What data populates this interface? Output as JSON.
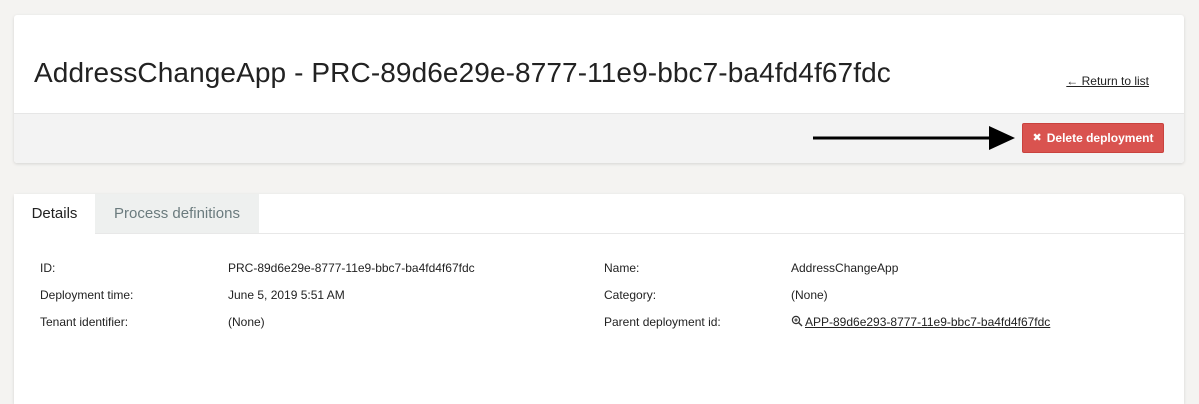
{
  "header": {
    "title": "AddressChangeApp - PRC-89d6e29e-8777-11e9-bbc7-ba4fd4f67fdc",
    "return_link": "← Return to list",
    "delete_icon": "✖",
    "delete_label": "Delete deployment",
    "delete_color": "#d9534f"
  },
  "tabs": [
    {
      "label": "Details",
      "active": true
    },
    {
      "label": "Process definitions",
      "active": false
    }
  ],
  "details": {
    "id_label": "ID:",
    "id_value": "PRC-89d6e29e-8777-11e9-bbc7-ba4fd4f67fdc",
    "deployment_time_label": "Deployment time:",
    "deployment_time_value": "June 5, 2019 5:51 AM",
    "tenant_label": "Tenant identifier:",
    "tenant_value": "(None)",
    "name_label": "Name:",
    "name_value": "AddressChangeApp",
    "category_label": "Category:",
    "category_value": "(None)",
    "parent_label": "Parent deployment id:",
    "parent_value": "APP-89d6e293-8777-11e9-bbc7-ba4fd4f67fdc",
    "parent_icon": "zoom-in-icon"
  }
}
